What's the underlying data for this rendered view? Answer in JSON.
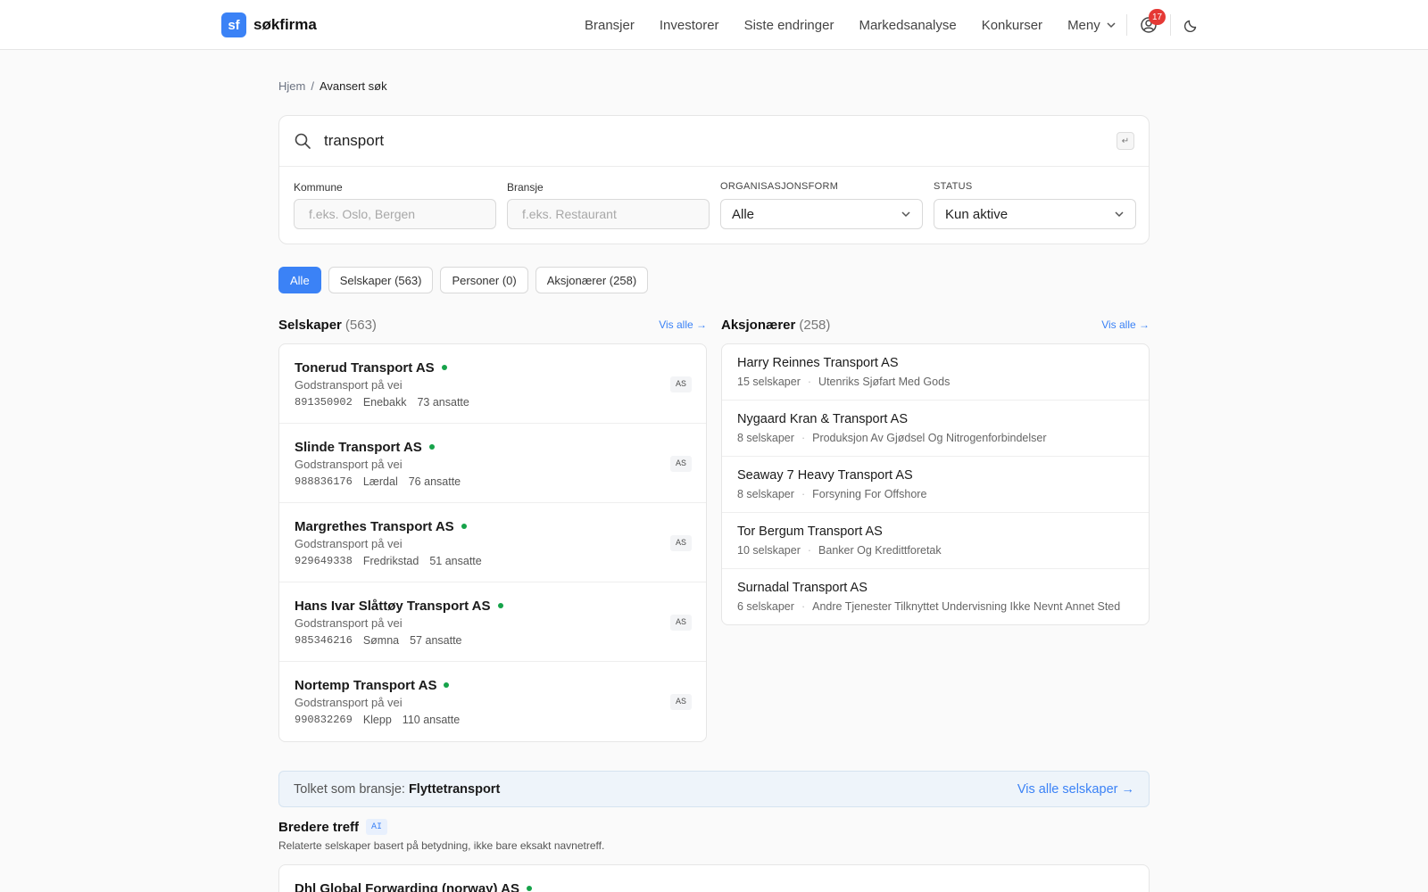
{
  "header": {
    "logo_mark": "sf",
    "logo_text": "søkfirma",
    "nav": [
      "Bransjer",
      "Investorer",
      "Siste endringer",
      "Markedsanalyse",
      "Konkurser"
    ],
    "menu_label": "Meny",
    "notifications_count": "17"
  },
  "breadcrumb": {
    "home": "Hjem",
    "sep": "/",
    "current": "Avansert søk"
  },
  "search": {
    "value": "transport",
    "enter_key": "↵",
    "filters": {
      "kommune_label": "Kommune",
      "kommune_placeholder": "f.eks. Oslo, Bergen",
      "bransje_label": "Bransje",
      "bransje_placeholder": "f.eks. Restaurant",
      "orgform_label": "ORGANISASJONSFORM",
      "orgform_value": "Alle",
      "status_label": "STATUS",
      "status_value": "Kun aktive"
    }
  },
  "tabs": [
    "Alle",
    "Selskaper (563)",
    "Personer (0)",
    "Aksjonærer (258)"
  ],
  "companies": {
    "title": "Selskaper",
    "count": "(563)",
    "see_all": "Vis alle →",
    "items": [
      {
        "name": "Tonerud Transport AS",
        "industry": "Godstransport på vei",
        "orgnr": "891350902",
        "place": "Enebakk",
        "employees": "73 ansatte",
        "form": "AS"
      },
      {
        "name": "Slinde Transport AS",
        "industry": "Godstransport på vei",
        "orgnr": "988836176",
        "place": "Lærdal",
        "employees": "76 ansatte",
        "form": "AS"
      },
      {
        "name": "Margrethes Transport AS",
        "industry": "Godstransport på vei",
        "orgnr": "929649338",
        "place": "Fredrikstad",
        "employees": "51 ansatte",
        "form": "AS"
      },
      {
        "name": "Hans Ivar Slåttøy Transport AS",
        "industry": "Godstransport på vei",
        "orgnr": "985346216",
        "place": "Sømna",
        "employees": "57 ansatte",
        "form": "AS"
      },
      {
        "name": "Nortemp Transport AS",
        "industry": "Godstransport på vei",
        "orgnr": "990832269",
        "place": "Klepp",
        "employees": "110 ansatte",
        "form": "AS"
      }
    ]
  },
  "shareholders": {
    "title": "Aksjonærer",
    "count": "(258)",
    "see_all": "Vis alle →",
    "items": [
      {
        "name": "Harry Reinnes Transport AS",
        "companies": "15 selskaper",
        "industry": "Utenriks Sjøfart Med Gods"
      },
      {
        "name": "Nygaard Kran & Transport AS",
        "companies": "8 selskaper",
        "industry": "Produksjon Av Gjødsel Og Nitrogenforbindelser"
      },
      {
        "name": "Seaway 7 Heavy Transport AS",
        "companies": "8 selskaper",
        "industry": "Forsyning For Offshore"
      },
      {
        "name": "Tor Bergum Transport AS",
        "companies": "10 selskaper",
        "industry": "Banker Og Kredittforetak"
      },
      {
        "name": "Surnadal Transport AS",
        "companies": "6 selskaper",
        "industry": "Andre Tjenester Tilknyttet Undervisning Ikke Nevnt Annet Sted"
      }
    ]
  },
  "interpreted": {
    "prefix": "Tolket som bransje:",
    "value": "Flyttetransport",
    "link": "Vis alle selskaper →"
  },
  "broader": {
    "title": "Bredere treff",
    "badge": "AI",
    "description": "Relaterte selskaper basert på betydning, ikke bare eksakt navnetreff.",
    "first_name": "Dhl Global Forwarding (norway) AS"
  },
  "colors": {
    "accent": "#3b82f6",
    "active_dot": "#16a34a",
    "badge": "#e53935"
  }
}
